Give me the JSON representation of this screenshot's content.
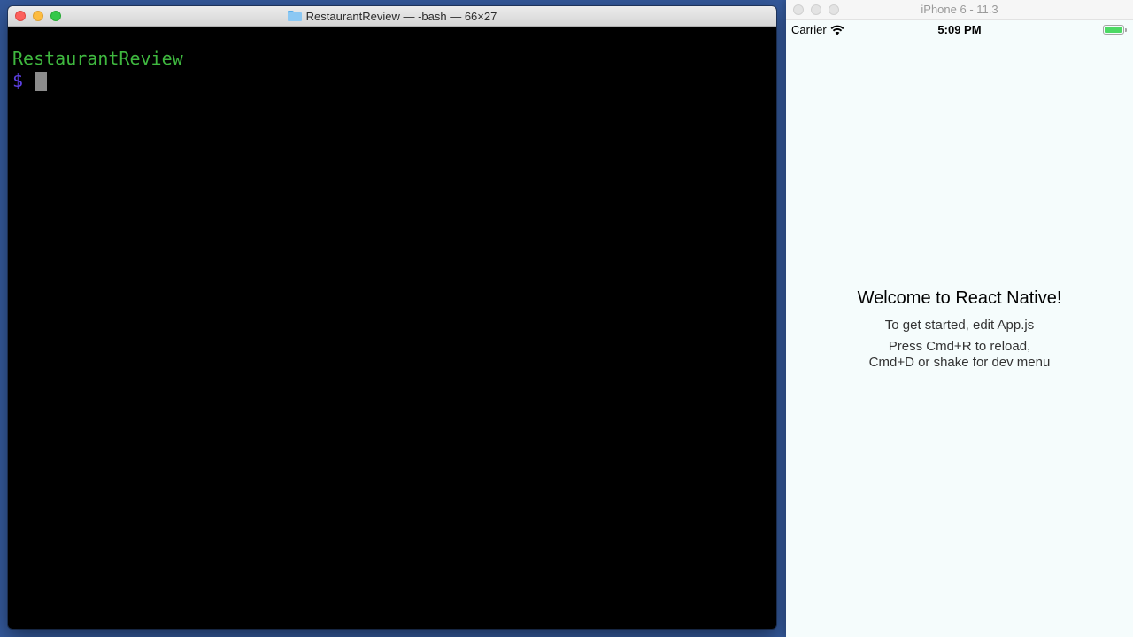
{
  "terminal": {
    "title": "RestaurantReview — -bash — 66×27",
    "directory": "RestaurantReview",
    "prompt": "$"
  },
  "simulator": {
    "title": "iPhone 6 - 11.3",
    "status": {
      "carrier": "Carrier",
      "time": "5:09 PM"
    },
    "app": {
      "welcome": "Welcome to React Native!",
      "instructions": "To get started, edit App.js",
      "reload_line1": "Press Cmd+R to reload,",
      "reload_line2": "Cmd+D or shake for dev menu"
    }
  },
  "colors": {
    "desktop": "#34599b",
    "terminal_bg": "#000000",
    "dir_text": "#3fb83f",
    "prompt_text": "#5b3fe0",
    "battery": "#4cd964"
  },
  "icons": [
    "folder-icon",
    "wifi-icon",
    "battery-icon"
  ]
}
